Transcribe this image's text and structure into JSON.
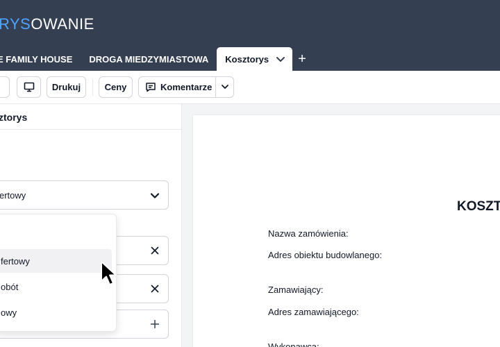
{
  "app": {
    "logo_part1": "RYS",
    "logo_part2": "OWANIE",
    "accent_color": "#4fa3ff",
    "header_color": "#353f52"
  },
  "tabs": [
    {
      "label": "E FAMILY HOUSE"
    },
    {
      "label": "DROGA MIEDZYMIASTOWA"
    },
    {
      "label": "Kosztorys",
      "active": true,
      "icon": "chevron-down-icon"
    }
  ],
  "tab_add_label": "+",
  "toolbar": {
    "monitor_icon": "monitor-icon",
    "print_label": "Drukuj",
    "prices_label": "Ceny",
    "comments_label": "Komentarze",
    "comments_icon": "comment-icon",
    "comments_chevron": "chevron-down-icon"
  },
  "left_panel": {
    "title": "ztorys",
    "select_value": "ertowy",
    "rows": [
      {
        "icon": "close-icon"
      },
      {
        "icon": "close-icon"
      },
      {
        "icon": "plus-icon"
      }
    ]
  },
  "dropdown": {
    "items": [
      {
        "label": "fertowy",
        "highlighted": true
      },
      {
        "label": "obót",
        "highlighted": false
      },
      {
        "label": "owy",
        "highlighted": false
      }
    ]
  },
  "document": {
    "title": "KOSZT",
    "fields": [
      {
        "label": "Nazwa zamówienia:"
      },
      {
        "label": "Adres obiektu budowlanego:"
      },
      {
        "label": "Zamawiający:"
      },
      {
        "label": "Adres zamawiającego:"
      },
      {
        "label": "Wykonawca:"
      }
    ]
  }
}
